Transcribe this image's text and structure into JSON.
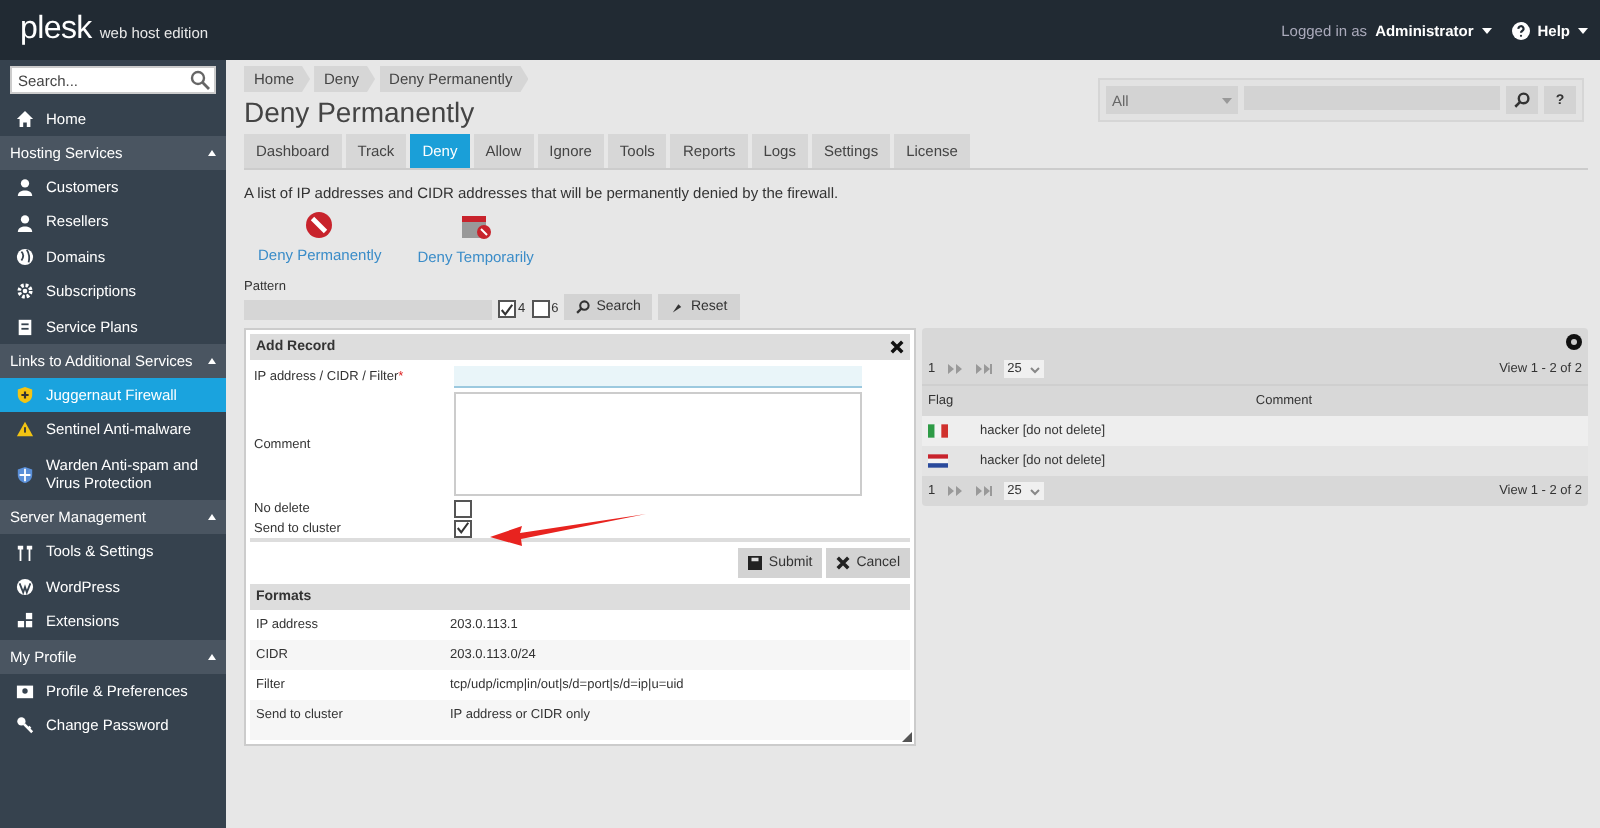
{
  "header": {
    "logo": "plesk",
    "edition": "web host edition",
    "logged_in_label": "Logged in as",
    "user": "Administrator",
    "help": "Help"
  },
  "sidebar": {
    "search": {
      "placeholder": "Search..."
    },
    "home": {
      "label": "Home",
      "selected": false
    },
    "sections": [
      {
        "title": "Hosting Services",
        "expanded": true,
        "items": [
          {
            "label": "Customers",
            "selected": false
          },
          {
            "label": "Resellers",
            "selected": false
          },
          {
            "label": "Domains",
            "selected": false
          },
          {
            "label": "Subscriptions",
            "selected": false
          },
          {
            "label": "Service Plans",
            "selected": false
          }
        ]
      },
      {
        "title": "Links to Additional Services",
        "expanded": true,
        "items": [
          {
            "label": "Juggernaut Firewall",
            "selected": true
          },
          {
            "label": "Sentinel Anti-malware",
            "selected": false
          },
          {
            "label": "Warden Anti-spam and Virus Protection",
            "selected": false
          }
        ]
      },
      {
        "title": "Server Management",
        "expanded": true,
        "items": [
          {
            "label": "Tools & Settings",
            "selected": false
          },
          {
            "label": "WordPress",
            "selected": false
          },
          {
            "label": "Extensions",
            "selected": false
          }
        ]
      },
      {
        "title": "My Profile",
        "expanded": true,
        "items": [
          {
            "label": "Profile & Preferences",
            "selected": false
          },
          {
            "label": "Change Password",
            "selected": false
          }
        ]
      }
    ]
  },
  "breadcrumbs": [
    "Home",
    "Deny",
    "Deny Permanently"
  ],
  "title": "Deny Permanently",
  "top_search": {
    "scope": "All",
    "help": "?"
  },
  "tabs": [
    {
      "label": "Dashboard",
      "selected": false
    },
    {
      "label": "Track",
      "selected": false
    },
    {
      "label": "Deny",
      "selected": true
    },
    {
      "label": "Allow",
      "selected": false
    },
    {
      "label": "Ignore",
      "selected": false
    },
    {
      "label": "Tools",
      "selected": false
    },
    {
      "label": "Reports",
      "selected": false
    },
    {
      "label": "Logs",
      "selected": false
    },
    {
      "label": "Settings",
      "selected": false
    },
    {
      "label": "License",
      "selected": false
    }
  ],
  "description": "A list of IP addresses and CIDR addresses that will be permanently denied by the firewall.",
  "actions": [
    {
      "label": "Deny Permanently"
    },
    {
      "label": "Deny Temporarily"
    }
  ],
  "filter": {
    "label": "Pattern",
    "options": [
      {
        "label": "4",
        "checked": true
      },
      {
        "label": "6",
        "checked": false
      }
    ],
    "buttons": [
      "Search",
      "Reset"
    ]
  },
  "dialog": {
    "title": "Add Record",
    "fields": [
      {
        "kind": "input",
        "label": "IP address / CIDR / Filter",
        "required_mark": "*"
      },
      {
        "kind": "textarea",
        "label": "Comment"
      },
      {
        "kind": "checkbox",
        "label": "No delete",
        "checked": false
      },
      {
        "kind": "checkbox",
        "label": "Send to cluster",
        "checked": true
      }
    ],
    "buttons": [
      "Submit",
      "Cancel"
    ],
    "formats_title": "Formats",
    "formats": [
      {
        "name": "IP address",
        "example": "203.0.113.1"
      },
      {
        "name": "CIDR",
        "example": "203.0.113.0/24"
      },
      {
        "name": "Filter",
        "example": "tcp/udp/icmp|in/out|s/d=port|s/d=ip|u=uid"
      },
      {
        "name": "Send to cluster",
        "example": "IP address or CIDR only"
      }
    ]
  },
  "grid": {
    "pager_top": {
      "page": "1",
      "per_page": "25",
      "view": "View 1 - 2 of 2"
    },
    "columns": [
      "Flag",
      "Comment"
    ],
    "rows": [
      {
        "kind": "italy",
        "comment": "hacker [do not delete]"
      },
      {
        "kind": "netherlands",
        "comment": "hacker [do not delete]"
      }
    ],
    "pager_bottom": {
      "page": "1",
      "per_page": "25",
      "view": "View 1 - 2 of 2"
    }
  }
}
